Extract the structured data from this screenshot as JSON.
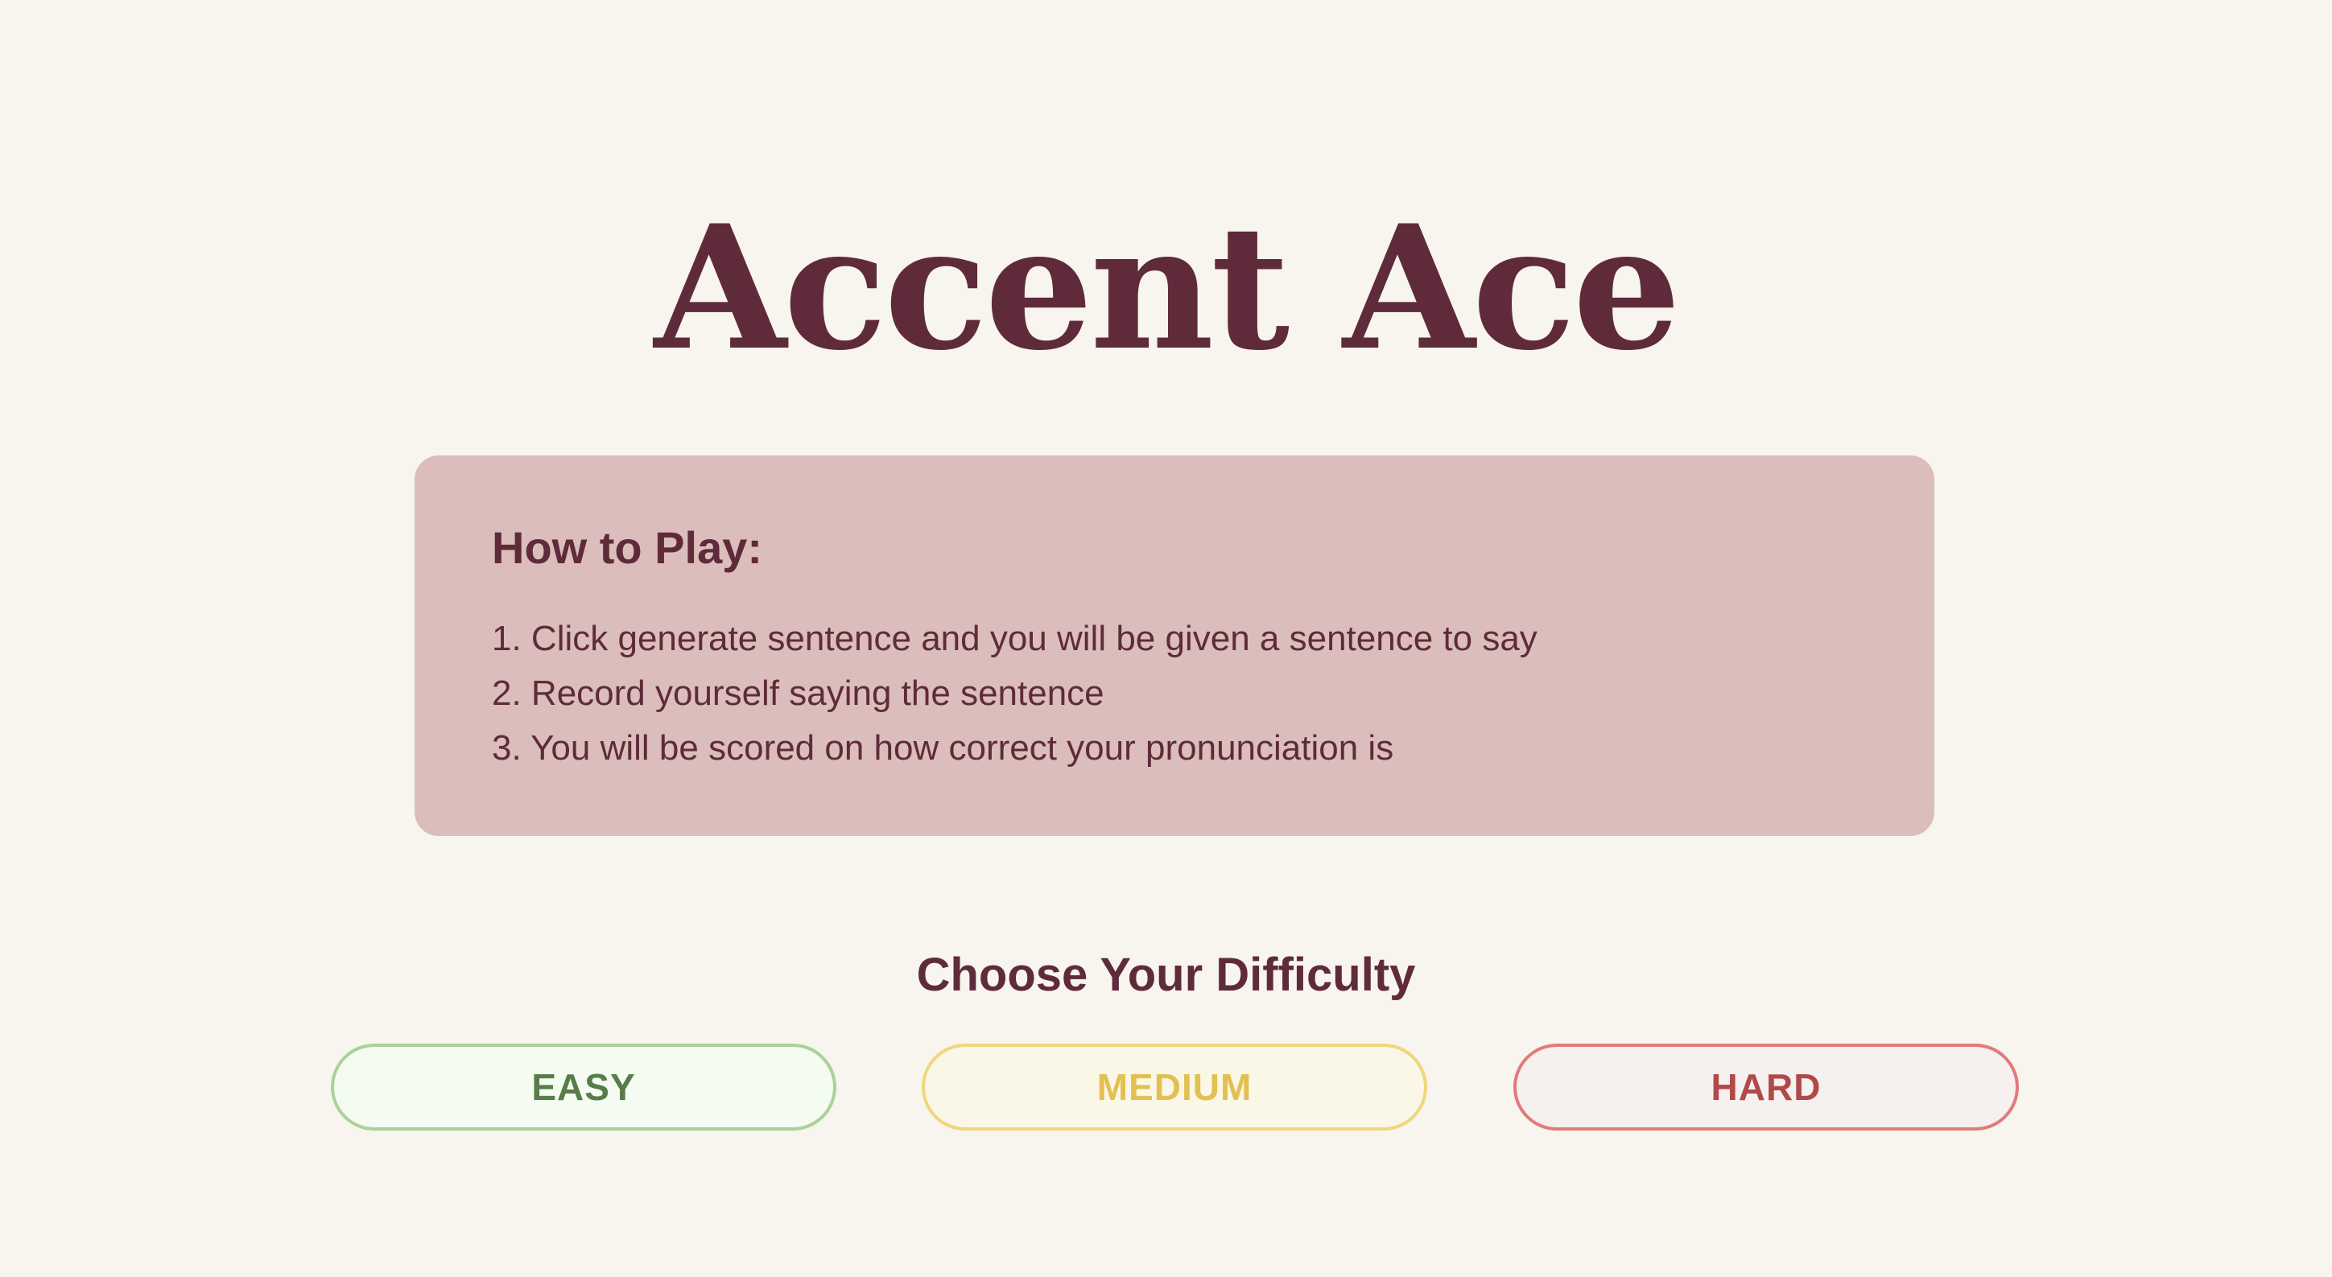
{
  "app": {
    "title": "Accent Ace"
  },
  "how_to": {
    "title": "How to Play:",
    "steps": [
      "1. Click generate sentence and you will be given a sentence to say",
      "2. Record yourself saying the sentence",
      "3. You will be scored on how correct your pronunciation is"
    ]
  },
  "difficulty": {
    "title": "Choose Your Difficulty",
    "options": [
      {
        "label": "EASY",
        "color": "#587c4a",
        "border": "#aad19a",
        "background": "#f4fbf1"
      },
      {
        "label": "MEDIUM",
        "color": "#e2c052",
        "border": "#f0d67c",
        "background": "#fbf7e6"
      },
      {
        "label": "HARD",
        "color": "#b04a4a",
        "border": "#e07b7b",
        "background": "#f6f0ee"
      }
    ]
  },
  "colors": {
    "background": "#f8f4ee",
    "primary_text": "#5f2b3a",
    "card_background": "#dbbebb"
  }
}
